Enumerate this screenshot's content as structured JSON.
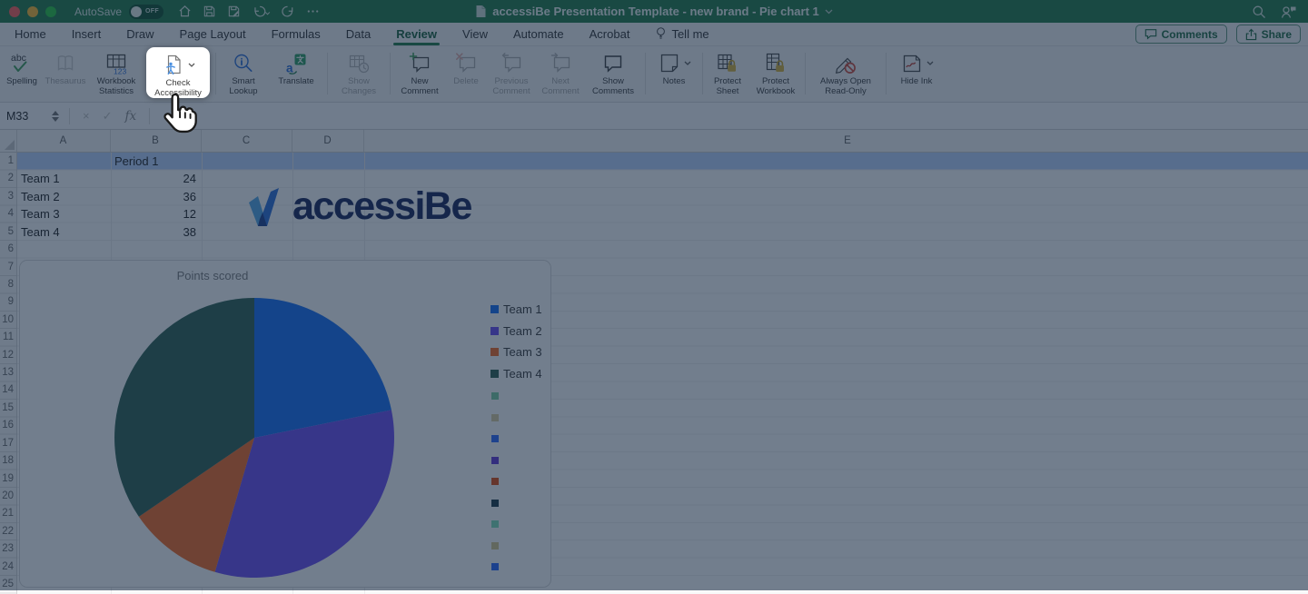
{
  "titlebar": {
    "autosave_label": "AutoSave",
    "autosave_state": "OFF",
    "title": "accessiBe Presentation Template - new brand - Pie chart 1",
    "quick_actions": [
      "home",
      "save",
      "save-as",
      "undo",
      "redo",
      "more"
    ],
    "right_icons": [
      "search",
      "contact"
    ]
  },
  "tabbar": {
    "tabs": [
      {
        "label": "Home"
      },
      {
        "label": "Insert"
      },
      {
        "label": "Draw"
      },
      {
        "label": "Page Layout"
      },
      {
        "label": "Formulas"
      },
      {
        "label": "Data"
      },
      {
        "label": "Review",
        "active": true
      },
      {
        "label": "View"
      },
      {
        "label": "Automate"
      },
      {
        "label": "Acrobat"
      },
      {
        "label": "Tell me",
        "icon": "lightbulb"
      }
    ],
    "comments_label": "Comments",
    "share_label": "Share"
  },
  "ribbon": {
    "groups": [
      [
        {
          "name": "spelling",
          "icon": "spelling",
          "label_lines": [
            "Spelling"
          ]
        },
        {
          "name": "thesaurus",
          "icon": "thesaurus",
          "label_lines": [
            "Thesaurus"
          ],
          "disabled": true
        },
        {
          "name": "workbook-statistics",
          "icon": "stats",
          "label_lines": [
            "Workbook",
            "Statistics"
          ]
        },
        {
          "name": "check-accessibility",
          "icon": "accessibility",
          "label_lines": [
            "Check",
            "Accessibility"
          ],
          "highlighted": true,
          "chevron": true
        }
      ],
      [
        {
          "name": "smart-lookup",
          "icon": "lookup",
          "label_lines": [
            "Smart",
            "Lookup"
          ]
        },
        {
          "name": "translate",
          "icon": "translate",
          "label_lines": [
            "Translate"
          ]
        }
      ],
      [
        {
          "name": "show-changes",
          "icon": "changes",
          "label_lines": [
            "Show",
            "Changes"
          ],
          "disabled": true
        }
      ],
      [
        {
          "name": "new-comment",
          "icon": "comment-new",
          "label_lines": [
            "New",
            "Comment"
          ]
        },
        {
          "name": "delete-comment",
          "icon": "comment-delete",
          "label_lines": [
            "Delete"
          ],
          "disabled": true
        },
        {
          "name": "previous-comment",
          "icon": "comment-prev",
          "label_lines": [
            "Previous",
            "Comment"
          ],
          "disabled": true
        },
        {
          "name": "next-comment",
          "icon": "comment-next",
          "label_lines": [
            "Next",
            "Comment"
          ],
          "disabled": true
        },
        {
          "name": "show-comments",
          "icon": "comment-show",
          "label_lines": [
            "Show",
            "Comments"
          ]
        }
      ],
      [
        {
          "name": "notes",
          "icon": "notes",
          "label_lines": [
            "Notes"
          ],
          "chevron": true
        }
      ],
      [
        {
          "name": "protect-sheet",
          "icon": "lock-sheet",
          "label_lines": [
            "Protect",
            "Sheet"
          ]
        },
        {
          "name": "protect-workbook",
          "icon": "lock-book",
          "label_lines": [
            "Protect",
            "Workbook"
          ]
        }
      ],
      [
        {
          "name": "always-open-read-only",
          "icon": "readonly",
          "label_lines": [
            "Always Open",
            "Read-Only"
          ]
        }
      ],
      [
        {
          "name": "hide-ink",
          "icon": "ink",
          "label_lines": [
            "Hide Ink"
          ],
          "chevron": true
        }
      ]
    ]
  },
  "formula_bar": {
    "name_box": "M33",
    "cancel_mark": "×",
    "enter_mark": "✓",
    "fx": "fx"
  },
  "sheet": {
    "columns": [
      "A",
      "B",
      "C",
      "D",
      "E"
    ],
    "row_count": 25,
    "selected_row": 1,
    "cells": [
      {
        "col": "B",
        "row": 1,
        "text": "Period 1",
        "align": "left"
      },
      {
        "col": "A",
        "row": 2,
        "text": "Team 1",
        "align": "left"
      },
      {
        "col": "B",
        "row": 2,
        "text": "24",
        "align": "right"
      },
      {
        "col": "A",
        "row": 3,
        "text": "Team 2",
        "align": "left"
      },
      {
        "col": "B",
        "row": 3,
        "text": "36",
        "align": "right"
      },
      {
        "col": "A",
        "row": 4,
        "text": "Team 3",
        "align": "left"
      },
      {
        "col": "B",
        "row": 4,
        "text": "12",
        "align": "right"
      },
      {
        "col": "A",
        "row": 5,
        "text": "Team 4",
        "align": "left"
      },
      {
        "col": "B",
        "row": 5,
        "text": "38",
        "align": "right"
      }
    ]
  },
  "logo": {
    "text": "accessiBe"
  },
  "chart_data": {
    "type": "pie",
    "title": "Points scored",
    "categories": [
      "Team 1",
      "Team 2",
      "Team 3",
      "Team 4"
    ],
    "values": [
      24,
      36,
      12,
      38
    ],
    "colors": [
      "#146ff8",
      "#6c4bf4",
      "#f76921",
      "#2d5f52"
    ],
    "legend_position": "right",
    "extra_swatches": [
      "#7acfa2",
      "#dccda0",
      "#2d69ff",
      "#6139d9",
      "#e14d11",
      "#193948",
      "#7fe1b9",
      "#d7c88c",
      "#2866ff"
    ]
  },
  "colors": {
    "excel_green": "#217a48",
    "selection_blue": "#bcd4fe",
    "accessibe_navy": "#17255a",
    "accessibe_blue": "#146ff8"
  }
}
